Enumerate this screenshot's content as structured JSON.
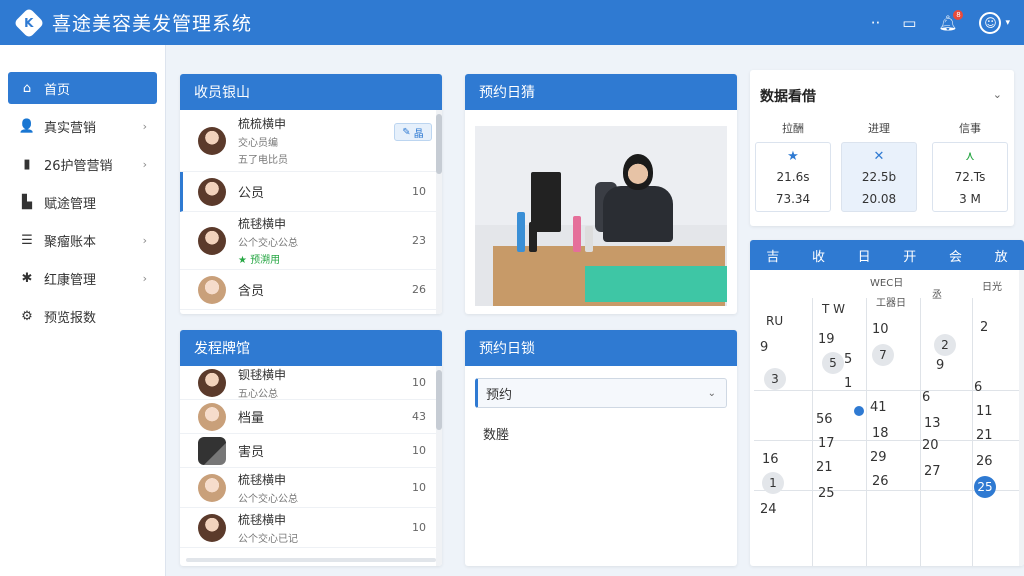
{
  "app": {
    "title": "喜途美容美发管理系统"
  },
  "topbar": {
    "notification_count": "8"
  },
  "sidebar": {
    "items": [
      {
        "label": "首页",
        "icon": "home-icon",
        "glyph": "⌂",
        "chevron": false
      },
      {
        "label": "真实营销",
        "icon": "user-icon",
        "glyph": "👤",
        "chevron": true
      },
      {
        "label": "26护管营销",
        "icon": "bottle-icon",
        "glyph": "▮",
        "chevron": true
      },
      {
        "label": "赋途管理",
        "icon": "document-icon",
        "glyph": "▙",
        "chevron": false
      },
      {
        "label": "聚瘤账本",
        "icon": "list-icon",
        "glyph": "☰",
        "chevron": true
      },
      {
        "label": "红康管理",
        "icon": "gear-icon",
        "glyph": "✱",
        "chevron": true
      },
      {
        "label": "预览报数",
        "icon": "settings-icon",
        "glyph": "⚙",
        "chevron": false
      }
    ]
  },
  "cashier": {
    "title": "收员银山",
    "rows": [
      {
        "main": "梳梳横申",
        "sub": "交心员编",
        "sub2": "五了电比员",
        "action": "晶"
      },
      {
        "main": "公员",
        "num": "10"
      },
      {
        "main": "梳毬横申",
        "sub": "公个交心公总",
        "num": "23",
        "green": "★ 预溯用"
      },
      {
        "main": "含员",
        "num": "26"
      }
    ]
  },
  "hair": {
    "title": "发程牌馆",
    "rows": [
      {
        "main": "钡毬横申",
        "sub": "五心公总",
        "num": "10"
      },
      {
        "main": "档量",
        "num": "43"
      },
      {
        "main": "害员",
        "num": "10"
      },
      {
        "main": "梳毬横申",
        "sub": "公个交心公总",
        "num": "10"
      },
      {
        "main": "梳毬横申",
        "sub": "公个交心已记",
        "num": "10"
      }
    ]
  },
  "booking_photo": {
    "title": "预约日猜"
  },
  "booking_form": {
    "title": "预约日锁",
    "select_value": "预约",
    "label": "数塍"
  },
  "dashboard": {
    "title": "数据看借",
    "stats": [
      {
        "label": "拉酬",
        "icon": "star-icon",
        "glyph": "★",
        "color": "#2f7ad2",
        "v1": "21.6s",
        "v2": "73.34"
      },
      {
        "label": "进理",
        "icon": "cross-icon",
        "glyph": "✕",
        "color": "#2f7ad2",
        "v1": "22.5b",
        "v2": "20.08"
      },
      {
        "label": "信事",
        "icon": "arrow-icon",
        "glyph": "⋏",
        "color": "#28a745",
        "v1": "72.Ts",
        "v2": "3 M"
      }
    ]
  },
  "calendar": {
    "header": [
      "吉",
      "收",
      "日",
      "开",
      "会",
      "放"
    ],
    "subs": [
      "WEC日",
      "工器日",
      "丞",
      "日光"
    ],
    "col_labels": [
      "RU",
      "T W"
    ],
    "days": [
      "3",
      "9",
      "19",
      "5",
      "5",
      "1",
      "10",
      "7",
      "2",
      "9",
      "2",
      "6",
      "56",
      "41",
      "6",
      "11",
      "16",
      "17",
      "18",
      "13",
      "20",
      "21",
      "21",
      "26",
      "29",
      "27",
      "1",
      "25",
      "26",
      "26",
      "24"
    ],
    "today": "25"
  }
}
